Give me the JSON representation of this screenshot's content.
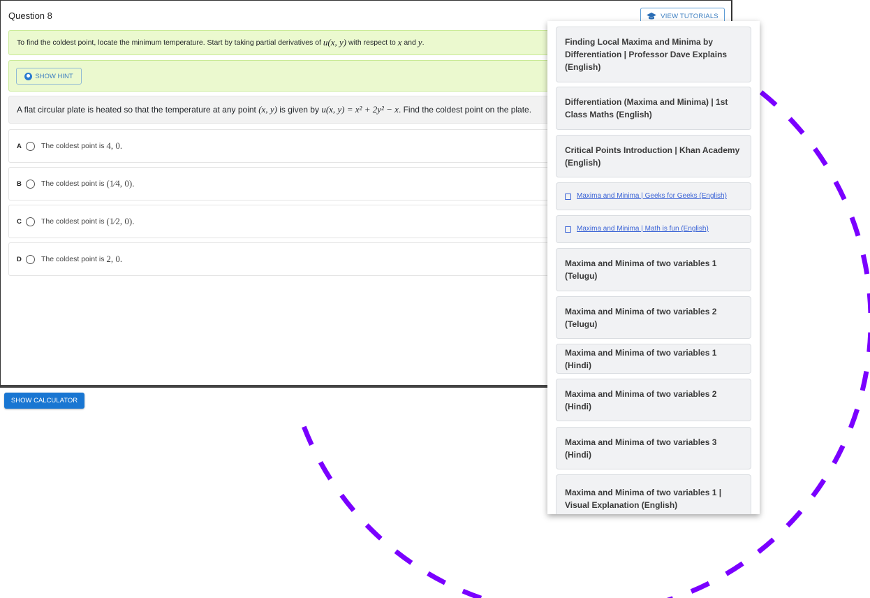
{
  "question": {
    "title": "Question 8",
    "view_tutorials_label": "VIEW TUTORIALS",
    "hint_text_before": "To find the coldest point, locate the minimum temperature. Start by taking partial derivatives of ",
    "hint_math_u": "u(x, y)",
    "hint_text_mid": " with respect to ",
    "hint_math_x": "x",
    "hint_text_and": " and ",
    "hint_math_y": "y",
    "hint_text_end": ".",
    "show_hint_label": "SHOW HINT",
    "prompt_before": "A flat circular plate is heated so that the temperature at any point ",
    "prompt_math_point": "(x, y)",
    "prompt_mid": " is given by ",
    "prompt_math_eq": "u(x, y) = x² + 2y² − x",
    "prompt_end": ". Find the coldest point on the plate.",
    "options": [
      {
        "letter": "A",
        "text": "The coldest point is ",
        "math": "4, 0",
        "end": "."
      },
      {
        "letter": "B",
        "text": "The coldest point is ",
        "math": "(1⁄4, 0)",
        "end": " ."
      },
      {
        "letter": "C",
        "text": "The coldest point is ",
        "math": "(1⁄2, 0)",
        "end": " ."
      },
      {
        "letter": "D",
        "text": "The coldest point is ",
        "math": "2, 0",
        "end": "."
      }
    ]
  },
  "show_calculator_label": "SHOW CALCULATOR",
  "tutorials": [
    {
      "label": "Finding Local Maxima and Minima by Differentiation | Professor Dave Explains (English)",
      "type": "video"
    },
    {
      "label": "Differentiation (Maxima and Minima) | 1st Class Maths (English)",
      "type": "video"
    },
    {
      "label": "Critical Points Introduction | Khan Academy (English)",
      "type": "video"
    },
    {
      "label": "Maxima and Minima | Geeks for Geeks (English)",
      "type": "link"
    },
    {
      "label": "Maxima and Minima | Math is fun (English)",
      "type": "link"
    },
    {
      "label": "Maxima and Minima of two variables 1 (Telugu)",
      "type": "video"
    },
    {
      "label": "Maxima and Minima of two variables 2 (Telugu)",
      "type": "video"
    },
    {
      "label": "Maxima and Minima of two variables 1 (Hindi)",
      "type": "video"
    },
    {
      "label": "Maxima and Minima of two variables 2 (Hindi)",
      "type": "video"
    },
    {
      "label": "Maxima and Minima of two variables 3 (Hindi)",
      "type": "video"
    },
    {
      "label": "Maxima and Minima of two variables 1 | Visual Explanation (English)",
      "type": "video"
    }
  ],
  "colors": {
    "accent": "#1976d2",
    "hint_bg": "#ebf9cf",
    "annotation": "#7a00ff"
  }
}
